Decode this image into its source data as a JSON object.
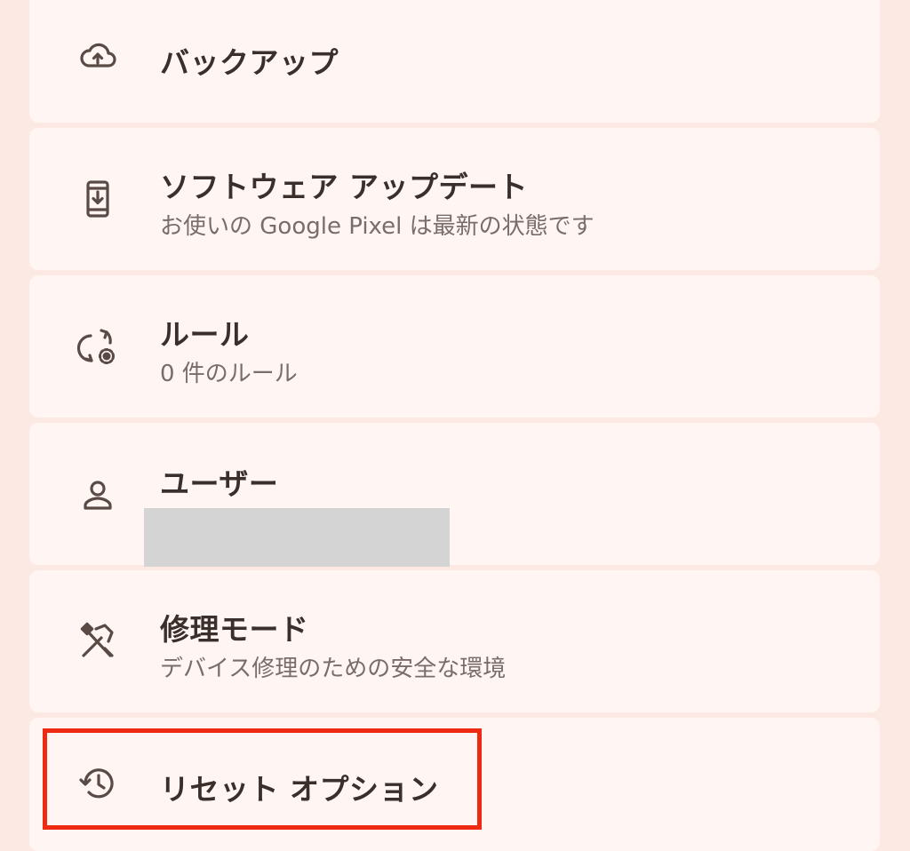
{
  "settings": {
    "backup": {
      "title": "バックアップ",
      "icon": "cloud-upload-icon"
    },
    "software_update": {
      "title": "ソフトウェア アップデート",
      "subtitle": "お使いの Google Pixel は最新の状態です",
      "icon": "system-update-icon"
    },
    "rules": {
      "title": "ルール",
      "subtitle": "0 件のルール",
      "icon": "rules-sync-gear-icon"
    },
    "users": {
      "title": "ユーザー",
      "subtitle": "",
      "icon": "person-icon"
    },
    "repair_mode": {
      "title": "修理モード",
      "subtitle": "デバイス修理のための安全な環境",
      "icon": "build-tools-icon"
    },
    "reset_options": {
      "title": "リセット オプション",
      "icon": "history-icon"
    }
  },
  "colors": {
    "background": "#fce9e4",
    "card": "#fff6f4",
    "highlight_border": "#ee2a12",
    "redaction": "#d4d4d4"
  }
}
